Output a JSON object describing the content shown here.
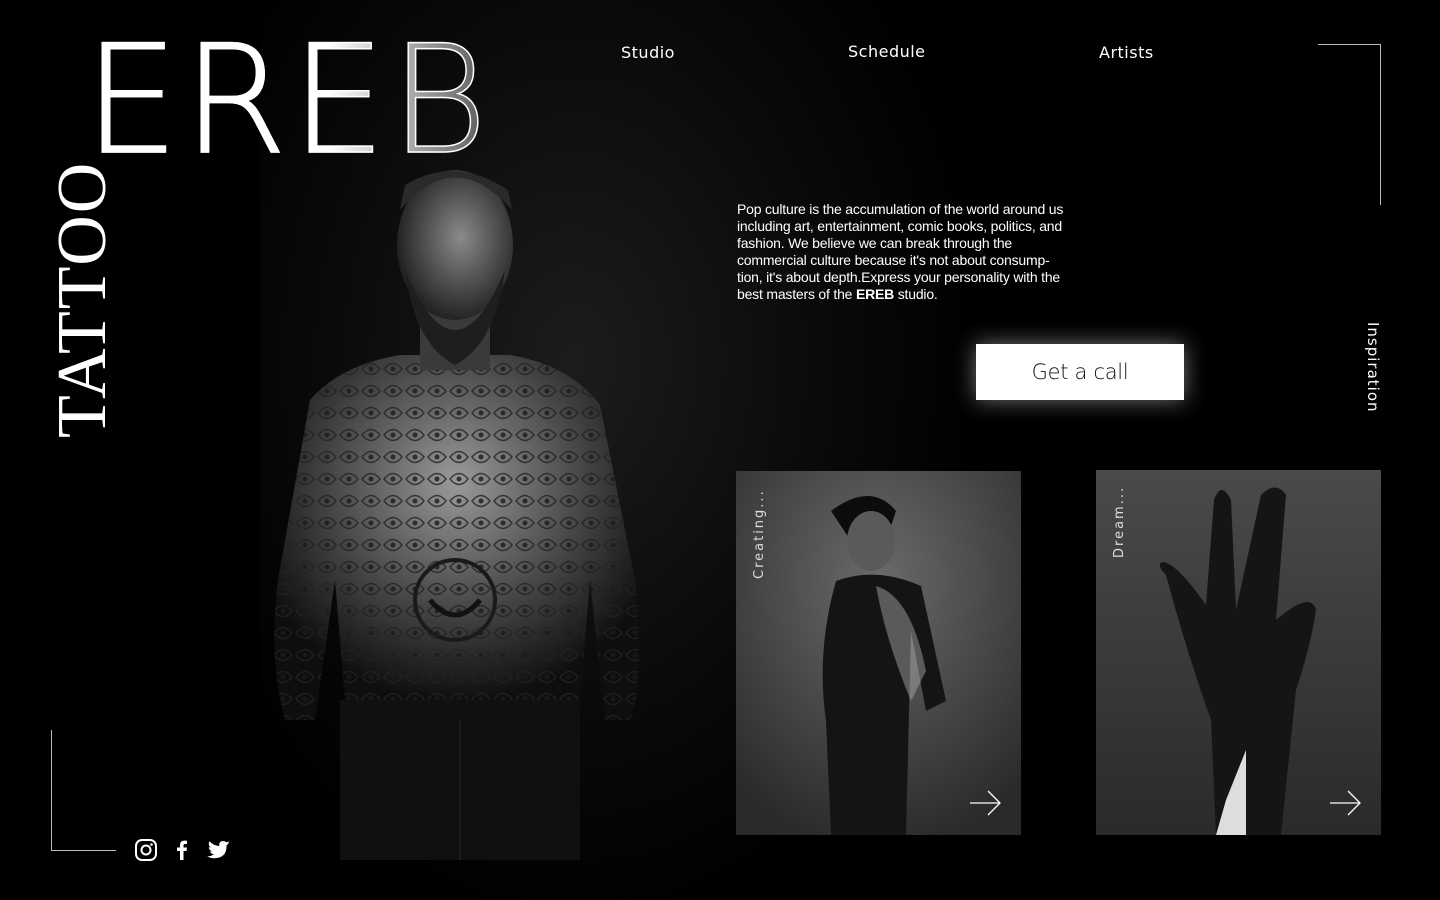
{
  "brand": {
    "logo_main": "EREB",
    "logo_vertical": "TATTOO"
  },
  "nav": {
    "items": [
      {
        "label": "Studio"
      },
      {
        "label": "Schedule"
      },
      {
        "label": "Artists"
      }
    ]
  },
  "intro": {
    "text_before": "Pop culture is the accumulation of the world around us including art, entertainment, comic books, politics, and fashion. We believe we can break through the commercial culture because it's not about consump-tion, it's about depth.Express your personality with the best masters of the ",
    "brand_bold": "EREB",
    "text_after": " studio."
  },
  "cta": {
    "label": "Get a call"
  },
  "side_label": "Inspiration",
  "cards": [
    {
      "label": "Creating...",
      "icon": "arrow-right-icon"
    },
    {
      "label": "Dream...",
      "icon": "arrow-right-icon"
    }
  ],
  "social": [
    {
      "icon": "instagram-icon"
    },
    {
      "icon": "facebook-icon"
    },
    {
      "icon": "twitter-icon"
    }
  ],
  "colors": {
    "background": "#000000",
    "text": "#ffffff",
    "cta_bg": "#ffffff",
    "cta_text": "#111111"
  }
}
